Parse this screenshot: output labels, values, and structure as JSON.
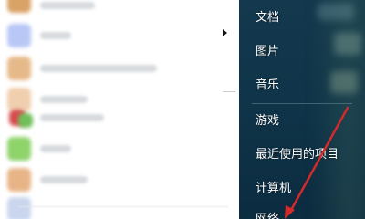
{
  "start_menu": {
    "right_items": [
      {
        "label": "文档"
      },
      {
        "label": "图片"
      },
      {
        "label": "音乐"
      },
      {
        "label": "游戏"
      },
      {
        "label": "最近使用的项目"
      },
      {
        "label": "计算机"
      },
      {
        "label": "网络"
      }
    ],
    "program_icons": [
      "program-icon",
      "program-icon",
      "program-icon",
      "program-icon",
      "program-icon",
      "program-icon",
      "program-icon"
    ]
  },
  "colors": {
    "panel_bg": "#10354a",
    "list_bg": "#ffffff",
    "arrow_red": "#d62a2a",
    "text": "#ffffff"
  }
}
